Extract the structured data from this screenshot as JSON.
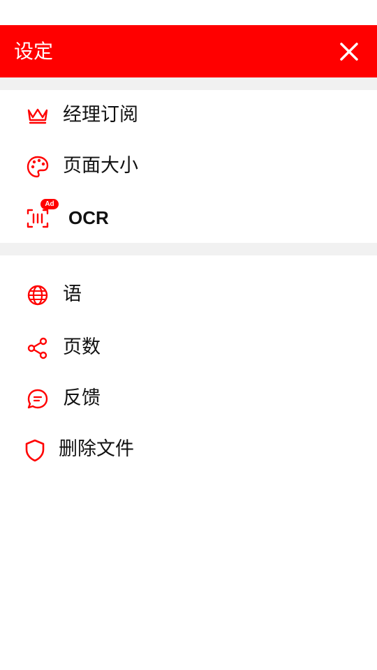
{
  "header": {
    "title": "设定",
    "close_icon": "close-icon"
  },
  "colors": {
    "accent": "#ff0000",
    "section_gap": "#f1f1f1",
    "text": "#111111"
  },
  "section1": {
    "items": [
      {
        "label": "经理订阅",
        "icon": "crown-icon"
      },
      {
        "label": "页面大小",
        "icon": "palette-icon"
      },
      {
        "label": "OCR",
        "icon": "scan-text-icon",
        "badge": "Ad"
      }
    ]
  },
  "section2": {
    "items": [
      {
        "label": "语",
        "icon": "globe-icon"
      },
      {
        "label": "页数",
        "icon": "share-icon"
      },
      {
        "label": "反馈",
        "icon": "chat-bubble-icon"
      },
      {
        "label": "删除文件",
        "icon": "shield-icon"
      }
    ]
  }
}
